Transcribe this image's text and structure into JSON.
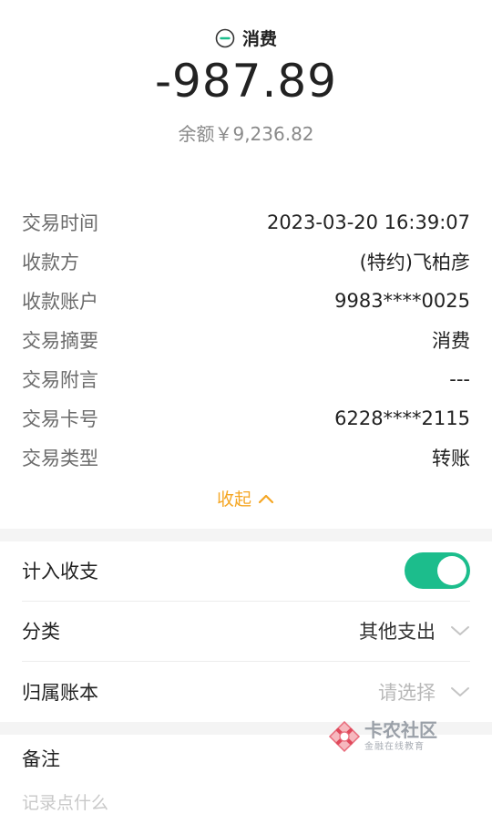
{
  "header": {
    "type_label": "消费",
    "amount": "-987.89",
    "balance": "余额￥9,236.82"
  },
  "details": [
    {
      "label": "交易时间",
      "value": "2023-03-20 16:39:07"
    },
    {
      "label": "收款方",
      "value": "(特约)飞柏彦"
    },
    {
      "label": "收款账户",
      "value": "9983****0025"
    },
    {
      "label": "交易摘要",
      "value": "消费"
    },
    {
      "label": "交易附言",
      "value": "---"
    },
    {
      "label": "交易卡号",
      "value": "6228****2115"
    },
    {
      "label": "交易类型",
      "value": "转账"
    }
  ],
  "collapse_label": "收起",
  "settings": {
    "include_label": "计入收支",
    "include_on": true,
    "category_label": "分类",
    "category_value": "其他支出",
    "ledger_label": "归属账本",
    "ledger_placeholder": "请选择"
  },
  "note": {
    "label": "备注",
    "placeholder": "记录点什么"
  },
  "watermark": {
    "title": "卡农社区",
    "subtitle": "金融在线教育"
  },
  "colors": {
    "accent_green": "#1cbd8c",
    "collapse_orange": "#f5a623"
  }
}
